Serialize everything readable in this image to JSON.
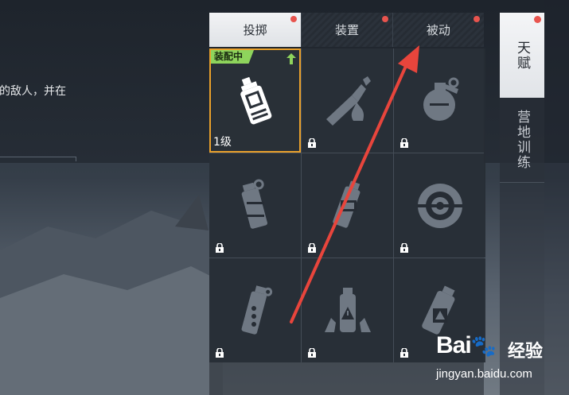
{
  "description_fragment": "的敌人，并在",
  "tabs": [
    {
      "label": "投掷",
      "active": true,
      "badge": true
    },
    {
      "label": "装置",
      "active": false,
      "badge": true
    },
    {
      "label": "被动",
      "active": false,
      "badge": true
    }
  ],
  "side_tabs": [
    {
      "label": "天赋",
      "active": true,
      "badge": true
    },
    {
      "label": "营地训练",
      "active": false,
      "badge": false
    }
  ],
  "selected_item": {
    "equipped_label": "装配中",
    "level_label": "1级"
  },
  "items": [
    {
      "icon": "grenade-canister-icon",
      "locked": false,
      "selected": true
    },
    {
      "icon": "molotov-icon",
      "locked": true
    },
    {
      "icon": "frag-grenade-icon",
      "locked": true
    },
    {
      "icon": "cluster-grenade-icon",
      "locked": true
    },
    {
      "icon": "sticky-grenade-icon",
      "locked": true
    },
    {
      "icon": "mine-icon",
      "locked": true
    },
    {
      "icon": "smoke-grenade-icon",
      "locked": true
    },
    {
      "icon": "gas-canister-icon",
      "locked": true
    },
    {
      "icon": "spray-canister-icon",
      "locked": true
    }
  ],
  "colors": {
    "selected_border": "#e9a02b",
    "equipped_badge": "#8ed45c",
    "notification_dot": "#e8544e",
    "annotation_arrow": "#e8453c"
  },
  "watermark": {
    "logo": "Bai",
    "logo_suffix": "du",
    "cn": "经验",
    "url": "jingyan.baidu.com"
  }
}
